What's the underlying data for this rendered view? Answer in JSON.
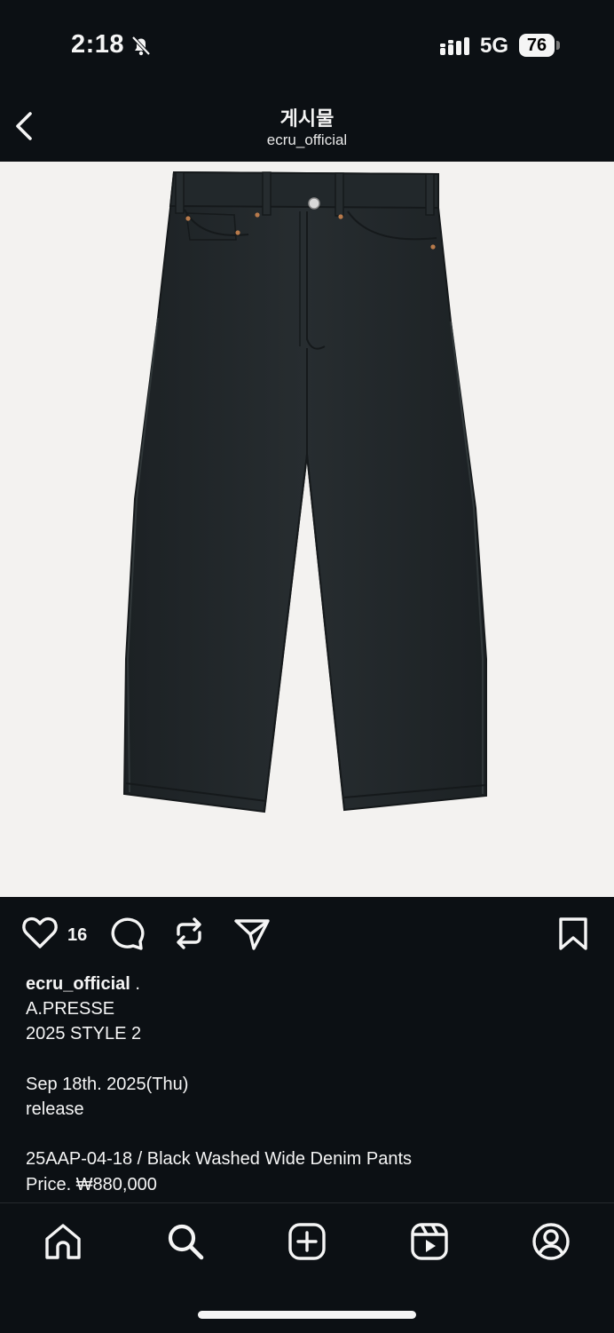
{
  "status_bar": {
    "time": "2:18",
    "network": "5G",
    "battery": "76"
  },
  "header": {
    "title": "게시물",
    "subtitle": "ecru_official"
  },
  "post": {
    "image_alt": "Black washed wide denim pants",
    "like_count": "16",
    "caption": {
      "username": "ecru_official",
      "username_suffix": " .",
      "lines": [
        "A.PRESSE",
        "2025 STYLE 2",
        "",
        "Sep 18th. 2025(Thu)",
        "release",
        "",
        "25AAP-04-18 / Black Washed Wide Denim Pants",
        "Price. ₩880,000"
      ]
    }
  },
  "icons": {
    "back": "chevron-left-icon",
    "like": "heart-icon",
    "comment": "comment-icon",
    "repost": "repost-icon",
    "share": "send-icon",
    "save": "bookmark-icon",
    "home": "home-icon",
    "search": "search-icon",
    "create": "plus-square-icon",
    "reels": "reels-icon",
    "profile": "profile-icon"
  },
  "colors": {
    "background": "#0c1014",
    "text": "#f5f5f5",
    "photo_bg": "#f3f2f0",
    "denim": "#23282b"
  }
}
